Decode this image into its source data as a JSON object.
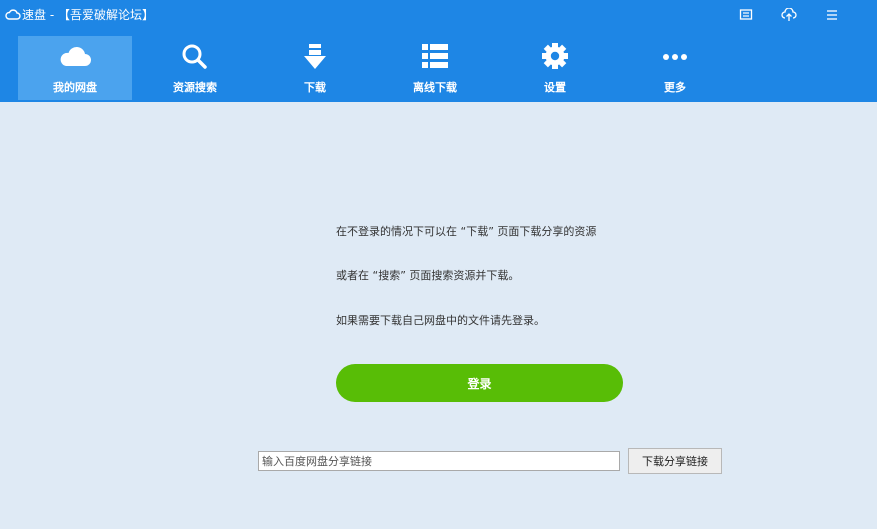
{
  "window": {
    "title": "速盘 - 【吾爱破解论坛】"
  },
  "nav": {
    "items": [
      {
        "label": "我的网盘",
        "icon": "cloud-icon",
        "active": true
      },
      {
        "label": "资源搜索",
        "icon": "search-icon",
        "active": false
      },
      {
        "label": "下载",
        "icon": "download-icon",
        "active": false
      },
      {
        "label": "离线下载",
        "icon": "list-icon",
        "active": false
      },
      {
        "label": "设置",
        "icon": "gear-icon",
        "active": false
      },
      {
        "label": "更多",
        "icon": "more-icon",
        "active": false
      }
    ]
  },
  "main": {
    "line1": "在不登录的情况下可以在 “下载” 页面下载分享的资源",
    "line2": "或者在 “搜索” 页面搜索资源并下载。",
    "line3": "如果需要下载自己网盘中的文件请先登录。",
    "login_label": "登录",
    "share_link_placeholder": "输入百度网盘分享链接",
    "download_share_label": "下载分享链接"
  },
  "colors": {
    "header": "#1e86e5",
    "active_tab": "#4ba3ee",
    "background": "#dfeaf5",
    "login_button": "#58bd06"
  }
}
